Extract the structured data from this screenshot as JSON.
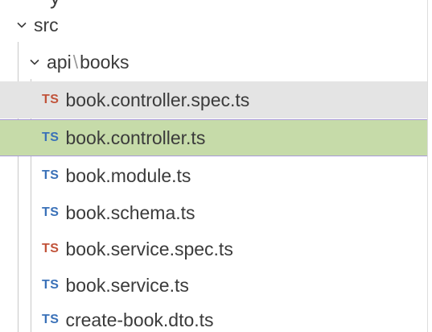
{
  "explorer": {
    "cutoff_glyph": "y",
    "folder_src": {
      "label": "src"
    },
    "folder_api": {
      "segment1": "api",
      "separator": "\\",
      "segment2": "books"
    },
    "files": [
      {
        "badge": "TS",
        "badge_color": "#c1533a",
        "name": "book.controller.spec.ts",
        "state": "hover"
      },
      {
        "badge": "TS",
        "badge_color": "#3a71b8",
        "name": "book.controller.ts",
        "state": "selected"
      },
      {
        "badge": "TS",
        "badge_color": "#3a71b8",
        "name": "book.module.ts",
        "state": "normal"
      },
      {
        "badge": "TS",
        "badge_color": "#3a71b8",
        "name": "book.schema.ts",
        "state": "normal"
      },
      {
        "badge": "TS",
        "badge_color": "#c1533a",
        "name": "book.service.spec.ts",
        "state": "normal"
      },
      {
        "badge": "TS",
        "badge_color": "#3a71b8",
        "name": "book.service.ts",
        "state": "normal"
      },
      {
        "badge": "TS",
        "badge_color": "#3a71b8",
        "name": "create-book.dto.ts",
        "state": "normal"
      }
    ]
  },
  "colors": {
    "selected_bg": "#c6dba9",
    "selected_border": "#a89ad8",
    "hover_bg": "#e4e4e4",
    "ts_test": "#c1533a",
    "ts_source": "#3a71b8"
  }
}
